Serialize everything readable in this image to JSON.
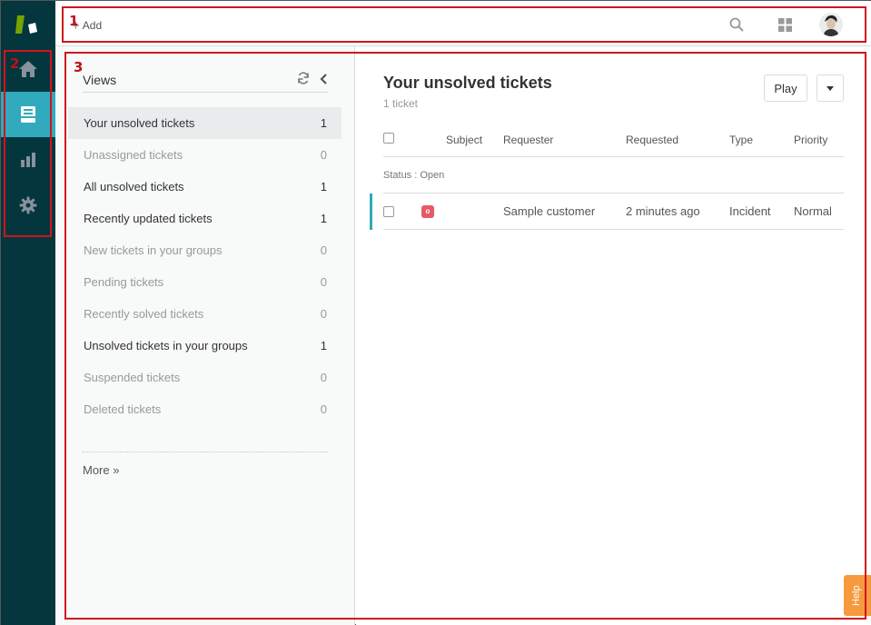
{
  "nav": {
    "logo": "zendesk-logo",
    "items": [
      {
        "name": "home",
        "icon": "home-icon",
        "active": false
      },
      {
        "name": "views",
        "icon": "inbox-icon",
        "active": true
      },
      {
        "name": "reporting",
        "icon": "bar-chart-icon",
        "active": false
      },
      {
        "name": "admin",
        "icon": "gear-icon",
        "active": false
      }
    ]
  },
  "header": {
    "add_label": "Add",
    "search_icon": "search-icon",
    "apps_icon": "grid-icon",
    "avatar": "user-avatar"
  },
  "views_panel": {
    "title": "Views",
    "items": [
      {
        "label": "Your unsolved tickets",
        "count": "1",
        "active": true,
        "dim": false
      },
      {
        "label": "Unassigned tickets",
        "count": "0",
        "active": false,
        "dim": true
      },
      {
        "label": "All unsolved tickets",
        "count": "1",
        "active": false,
        "dim": false
      },
      {
        "label": "Recently updated tickets",
        "count": "1",
        "active": false,
        "dim": false
      },
      {
        "label": "New tickets in your groups",
        "count": "0",
        "active": false,
        "dim": true
      },
      {
        "label": "Pending tickets",
        "count": "0",
        "active": false,
        "dim": true
      },
      {
        "label": "Recently solved tickets",
        "count": "0",
        "active": false,
        "dim": true
      },
      {
        "label": "Unsolved tickets in your groups",
        "count": "1",
        "active": false,
        "dim": false
      },
      {
        "label": "Suspended tickets",
        "count": "0",
        "active": false,
        "dim": true
      },
      {
        "label": "Deleted tickets",
        "count": "0",
        "active": false,
        "dim": true
      }
    ],
    "more_label": "More »"
  },
  "main": {
    "title": "Your unsolved tickets",
    "ticket_count": "1 ticket",
    "play_label": "Play",
    "columns": {
      "subject": "Subject",
      "requester": "Requester",
      "requested": "Requested",
      "type": "Type",
      "priority": "Priority"
    },
    "group_label": "Status : Open",
    "rows": [
      {
        "status_letter": "o",
        "requester": "Sample customer",
        "requested": "2 minutes ago",
        "type": "Incident",
        "priority": "Normal"
      }
    ]
  },
  "help_label": "Help",
  "annotations": [
    "1",
    "2",
    "3"
  ],
  "colors": {
    "nav_bg": "#03363d",
    "accent": "#30aabc",
    "status_open": "#e35b66",
    "help": "#f79a3e",
    "annotation": "#d0141e"
  }
}
